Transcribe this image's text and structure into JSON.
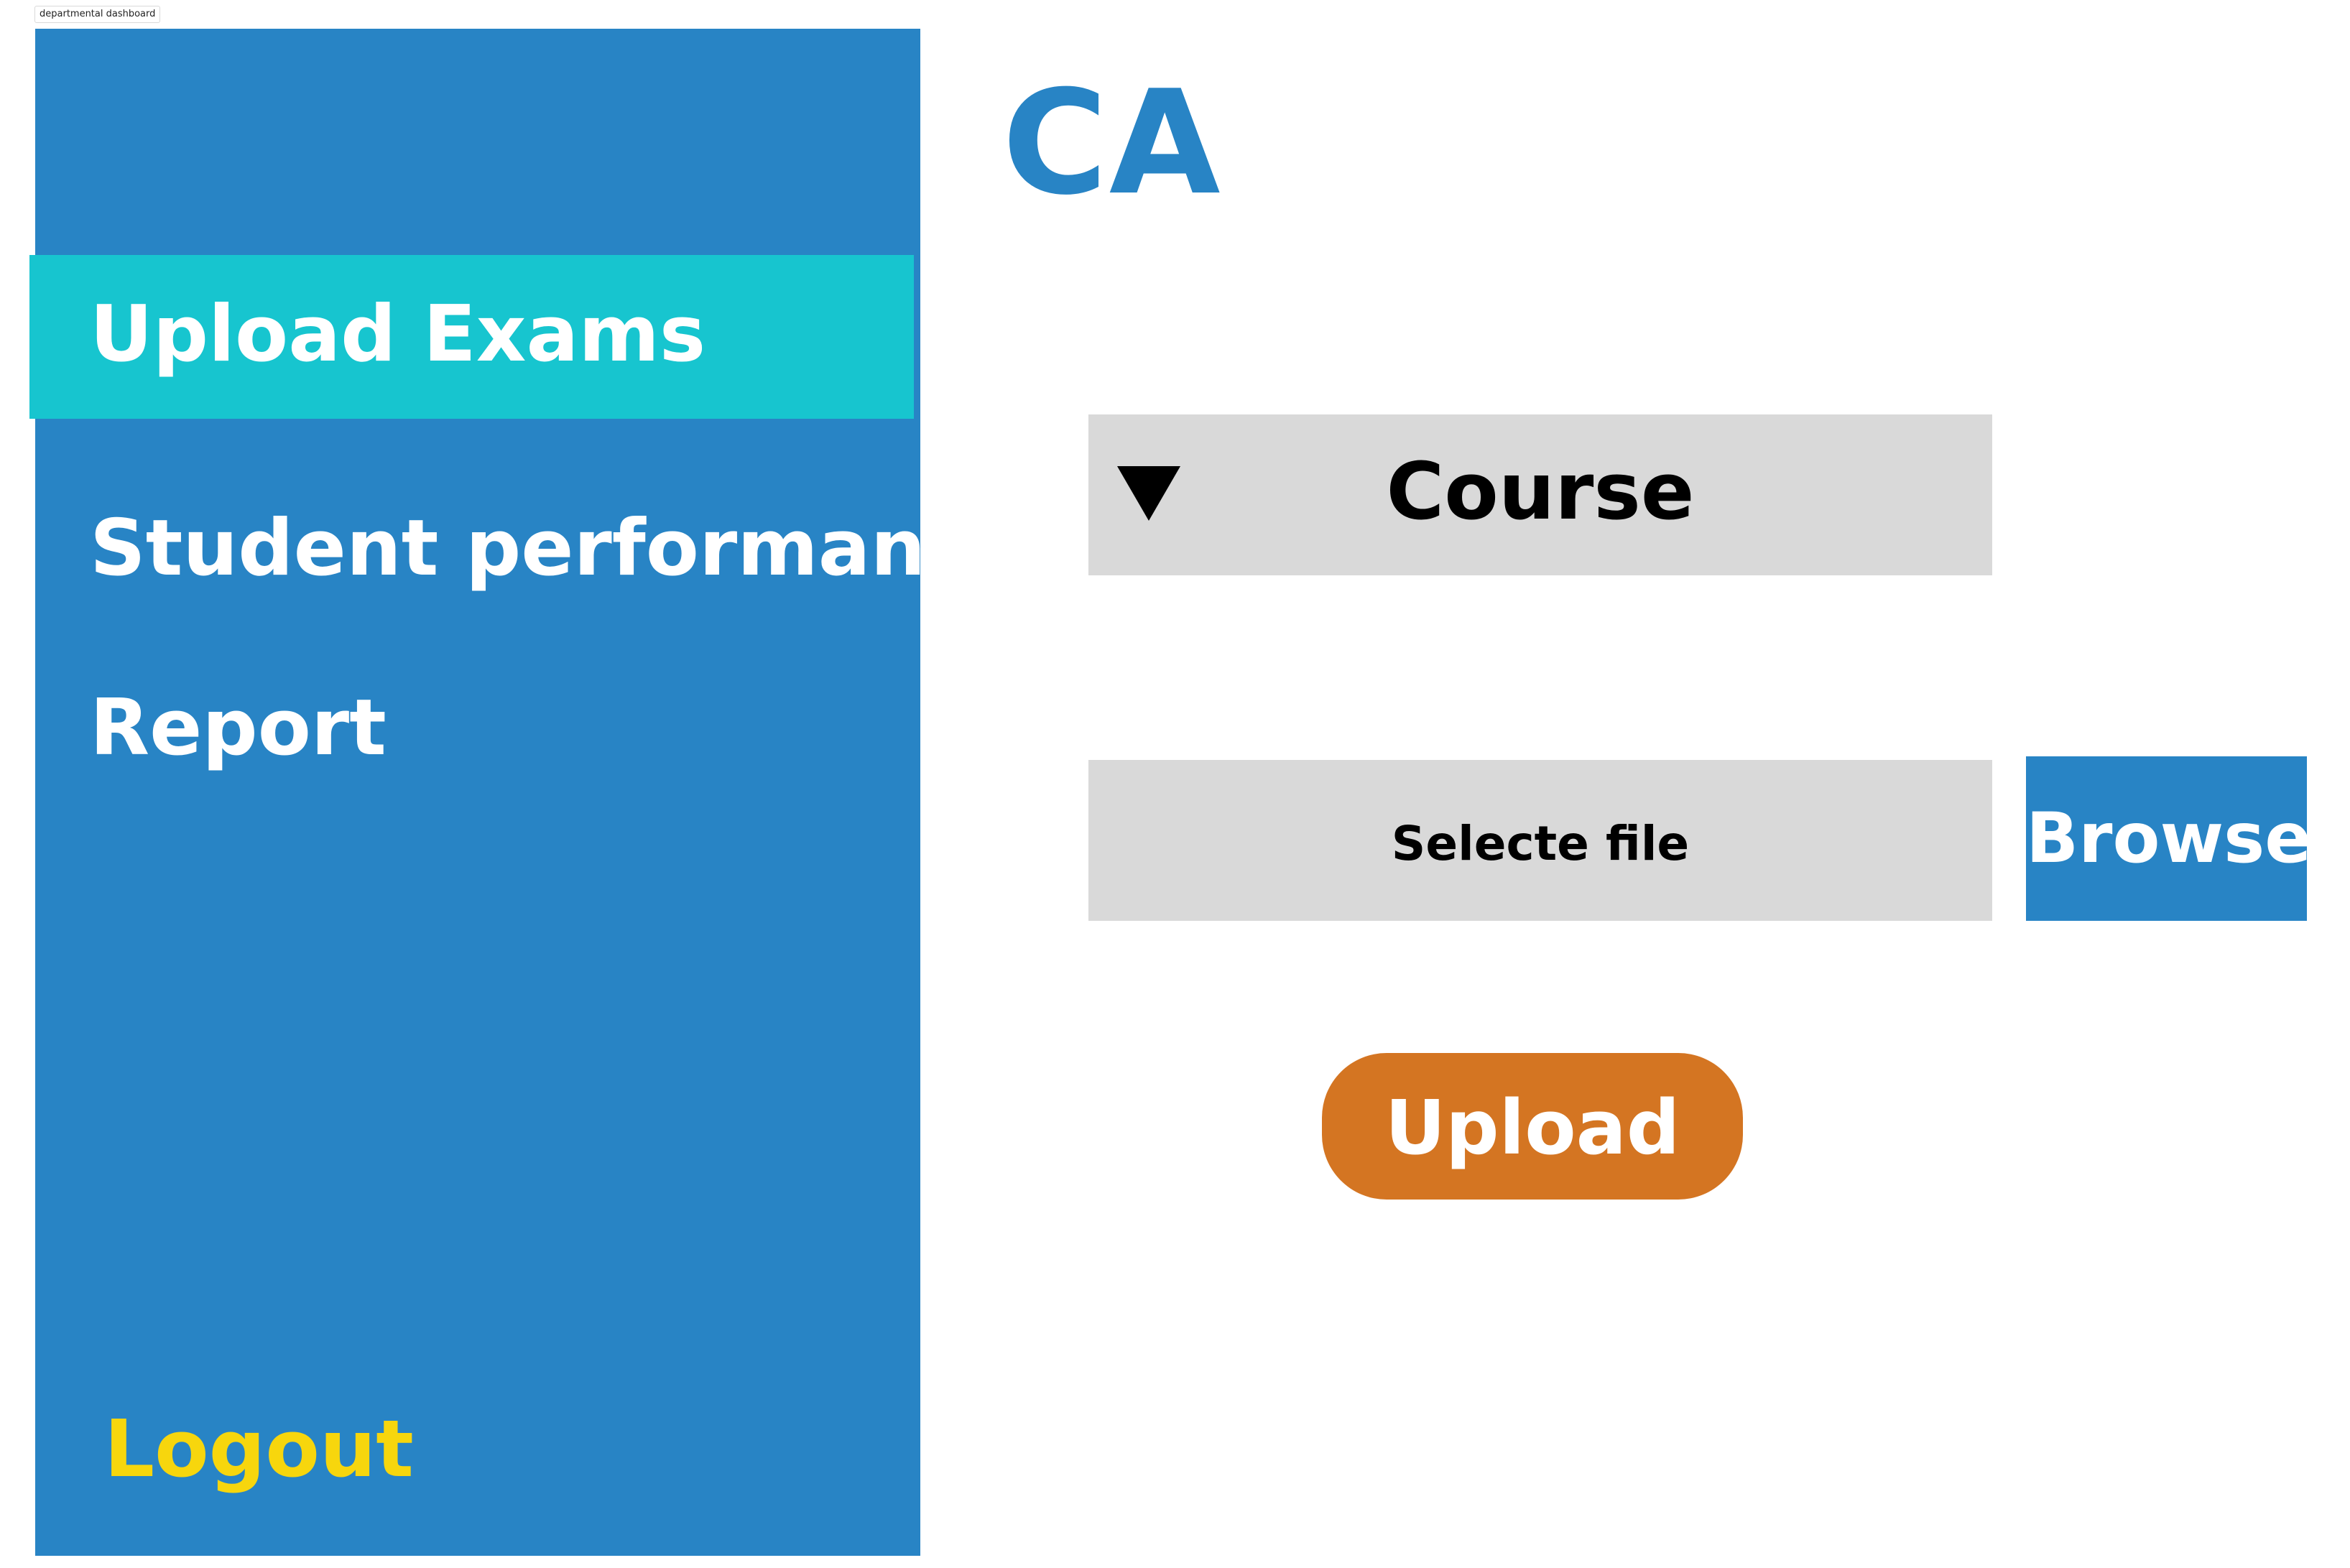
{
  "frame": {
    "label": "departmental dashboard"
  },
  "sidebar": {
    "items": [
      {
        "label": "Upload Exams",
        "active": true
      },
      {
        "label": "Student performance",
        "active": false
      },
      {
        "label": "Report",
        "active": false
      }
    ],
    "logout_label": "Logout"
  },
  "main": {
    "title": "CA",
    "course_select": {
      "label": "Course",
      "icon": "triangle-down-icon"
    },
    "file_field": {
      "placeholder": "Selecte file"
    },
    "browse_label": "Browse",
    "upload_label": "Upload"
  },
  "colors": {
    "primary": "#2884c5",
    "active_nav": "#17c5cf",
    "logout": "#f7d60d",
    "field_bg": "#d9d9d9",
    "upload_button": "#d47522"
  }
}
